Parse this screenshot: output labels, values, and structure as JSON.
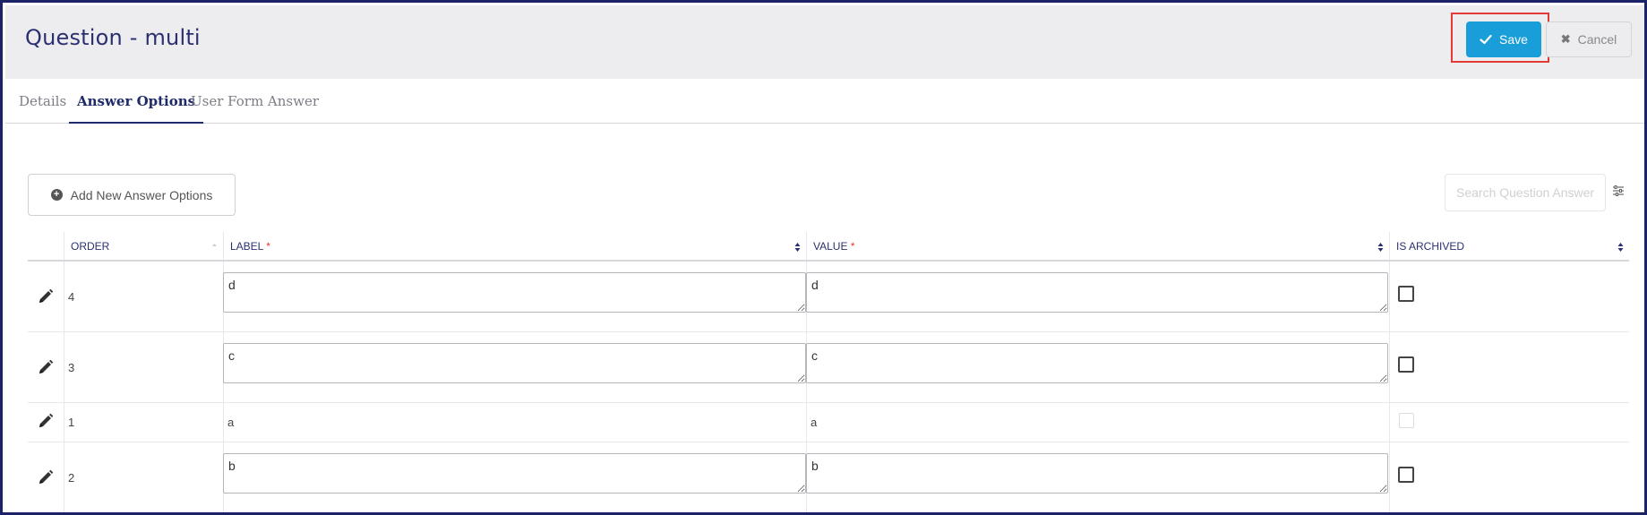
{
  "page": {
    "title": "Question - multi"
  },
  "actions": {
    "save_label": "Save",
    "cancel_label": "Cancel"
  },
  "tabs": [
    {
      "label": "Details"
    },
    {
      "label": "Answer Options"
    },
    {
      "label": "User Form Answer"
    }
  ],
  "toolbar": {
    "add_label": "Add New Answer Options",
    "search_placeholder": "Search Question Answer"
  },
  "table": {
    "columns": {
      "order": "ORDER",
      "label": "LABEL",
      "value": "VALUE",
      "archived": "IS ARCHIVED",
      "required_mark": "*"
    },
    "rows": [
      {
        "order": "4",
        "label": "d",
        "value": "d",
        "editing": true,
        "archived": false
      },
      {
        "order": "3",
        "label": "c",
        "value": "c",
        "editing": true,
        "archived": false
      },
      {
        "order": "1",
        "label": "a",
        "value": "a",
        "editing": false,
        "archived": false
      },
      {
        "order": "2",
        "label": "b",
        "value": "b",
        "editing": true,
        "archived": false
      }
    ]
  },
  "colors": {
    "primary": "#1a9ed9",
    "header_bg": "#ededf0",
    "accent": "#1f2a6b",
    "highlight": "#e53935"
  }
}
